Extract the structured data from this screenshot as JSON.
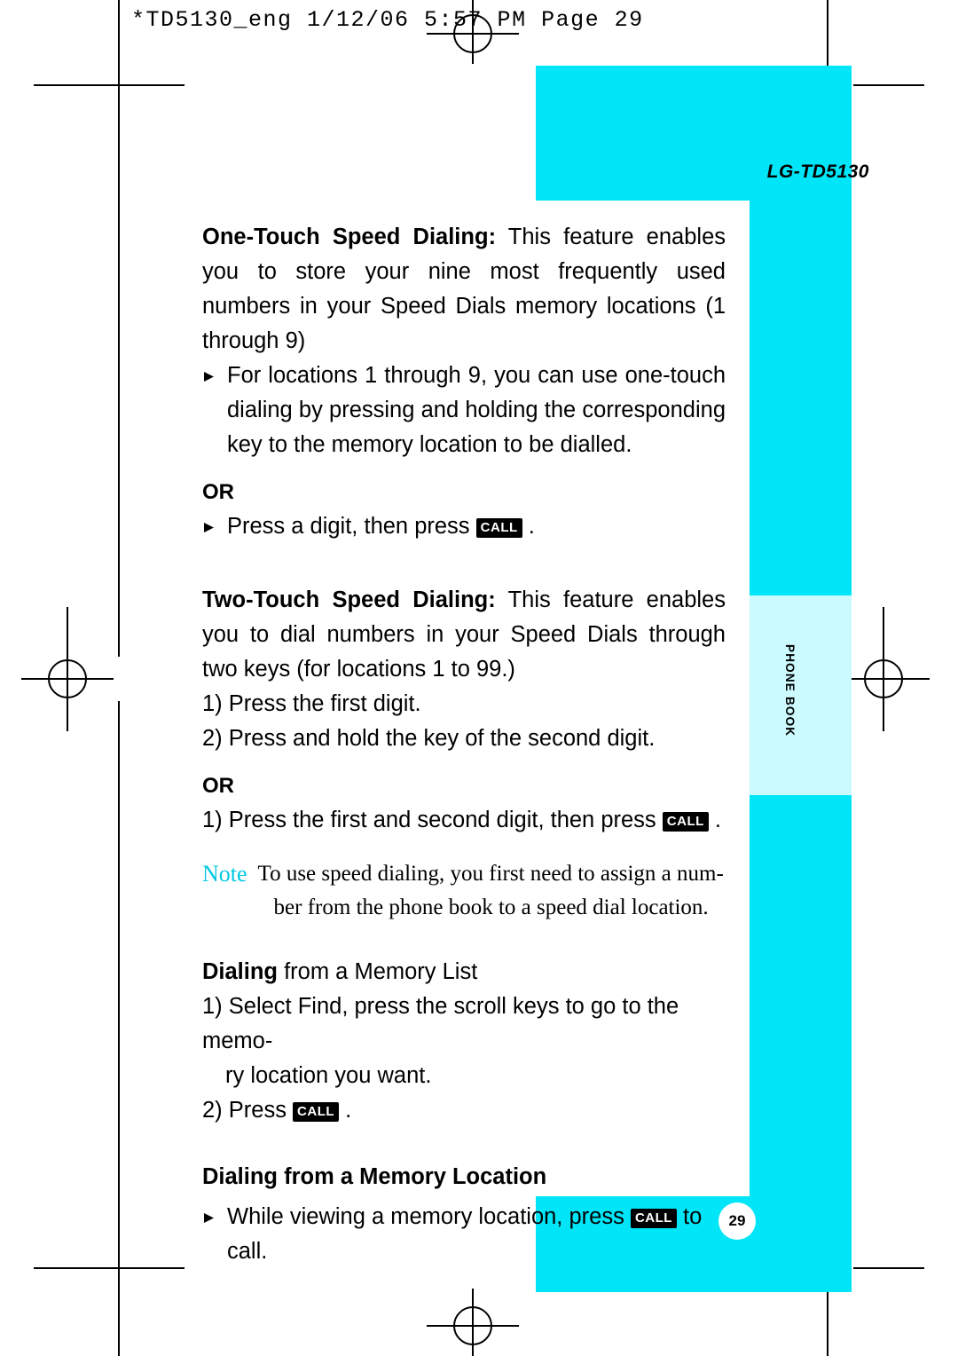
{
  "slug": "*TD5130_eng  1/12/06  5:57 PM  Page  29",
  "model_label": "LG-TD5130",
  "tab_label": "PHONE BOOK",
  "page_number": "29",
  "colors": {
    "cyan": "#00e5f7",
    "cyan_light": "#ccfbff",
    "note_accent": "#00c8e0"
  },
  "sections": {
    "one_touch": {
      "title": "One-Touch Speed Dialing",
      "title_sep": ":",
      "body": "This feature enables you to store your nine most frequently used numbers in your Speed Dials memory locations (1 through 9)",
      "bullet": "For locations 1 through 9, you can use one-touch dialing by pressing and holding the corresponding key  to the memory location to be dialled.",
      "or": "OR",
      "or_bullet_pre": "Press a digit, then press",
      "or_bullet_key": "CALL",
      "or_bullet_post": "."
    },
    "two_touch": {
      "title": "Two-Touch Speed Dialing",
      "title_sep": ":",
      "body": "This feature enables you to dial numbers in your Speed Dials through two keys (for locations 1 to 99.)",
      "step1": "1) Press the first digit.",
      "step2": "2) Press and hold the key of the second digit.",
      "or": "OR",
      "or_step_pre": "1) Press the first and second digit, then press",
      "or_step_key": "CALL",
      "or_step_post": "."
    },
    "note": {
      "label": "Note",
      "line1": "To use speed dialing, you first need to assign a num-",
      "line2": "ber from the phone book to a speed dial location."
    },
    "memory_list": {
      "title_bold": "Dialing",
      "title_rest": " from a Memory List",
      "step1": "1) Select Find, press the scroll keys to go to the memo-",
      "step1_cont": "ry location you want.",
      "step2_pre": "2) Press",
      "step2_key": "CALL",
      "step2_post": "."
    },
    "memory_location": {
      "title": "Dialing from a Memory Location",
      "bullet_pre": "While viewing a memory location, press",
      "bullet_key": "CALL",
      "bullet_post": "to call."
    }
  }
}
